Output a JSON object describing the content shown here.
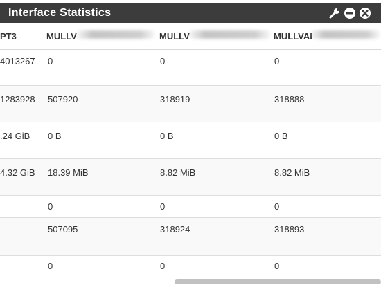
{
  "titlebar": {
    "title": "Interface Statistics",
    "icons": [
      "wrench-icon",
      "minus-circle-icon",
      "close-circle-icon"
    ]
  },
  "columns": [
    "PT3",
    "MULLV",
    "MULLV",
    "MULLVAI"
  ],
  "rows": [
    [
      "4013267",
      "0",
      "0",
      "0"
    ],
    [
      "1283928",
      "507920",
      "318919",
      "318888"
    ],
    ".24 GiB|0 B|0 B|0 B",
    [
      "4.32 GiB",
      "18.39 MiB",
      "8.82 MiB",
      "8.82 MiB"
    ],
    [
      "",
      "0",
      "0",
      "0"
    ],
    [
      "",
      "507095",
      "318924",
      "318893"
    ],
    [
      "",
      "0",
      "0",
      "0"
    ]
  ]
}
